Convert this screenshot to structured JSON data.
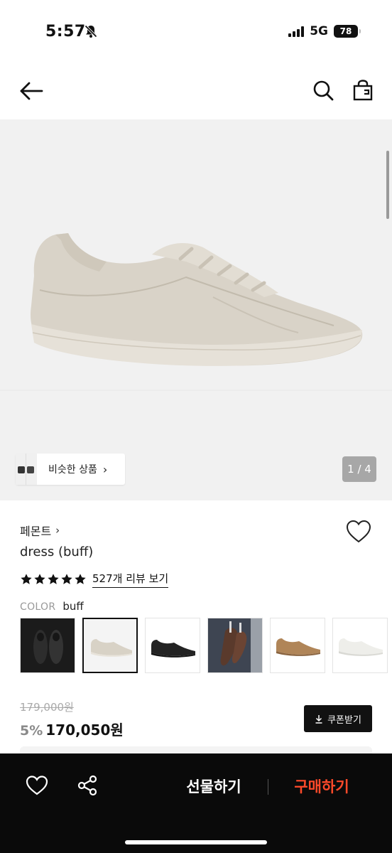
{
  "status_bar": {
    "time": "5:57",
    "network": "5G",
    "battery": "78",
    "icons": [
      "bell-slash-icon",
      "signal-icon",
      "battery-icon"
    ]
  },
  "nav": {
    "icons": [
      "arrow-left-icon",
      "search-icon",
      "shopping-bag-icon"
    ]
  },
  "gallery": {
    "similar_label": "비슷한 상품",
    "page_indicator": "1 / 4",
    "current_page": 1,
    "total_pages": 4
  },
  "product": {
    "brand": "페몬트",
    "name": "dress (buff)",
    "rating": 5,
    "review_link": "527개 리뷰 보기",
    "color_label": "COLOR",
    "color_value": "buff",
    "swatches": [
      {
        "name": "black-pair",
        "selected": false
      },
      {
        "name": "buff",
        "selected": true
      },
      {
        "name": "black",
        "selected": false
      },
      {
        "name": "brown-lifestyle",
        "selected": false
      },
      {
        "name": "tan",
        "selected": false
      },
      {
        "name": "white",
        "selected": false
      }
    ],
    "original_price": "179,000원",
    "discount": "5%",
    "sale_price": "170,050원",
    "coupon_label": "쿠폰받기"
  },
  "action_bar": {
    "gift_label": "선물하기",
    "buy_label": "구매하기",
    "buy_color": "#ff4a2a",
    "icons": [
      "heart-icon",
      "share-icon"
    ]
  }
}
